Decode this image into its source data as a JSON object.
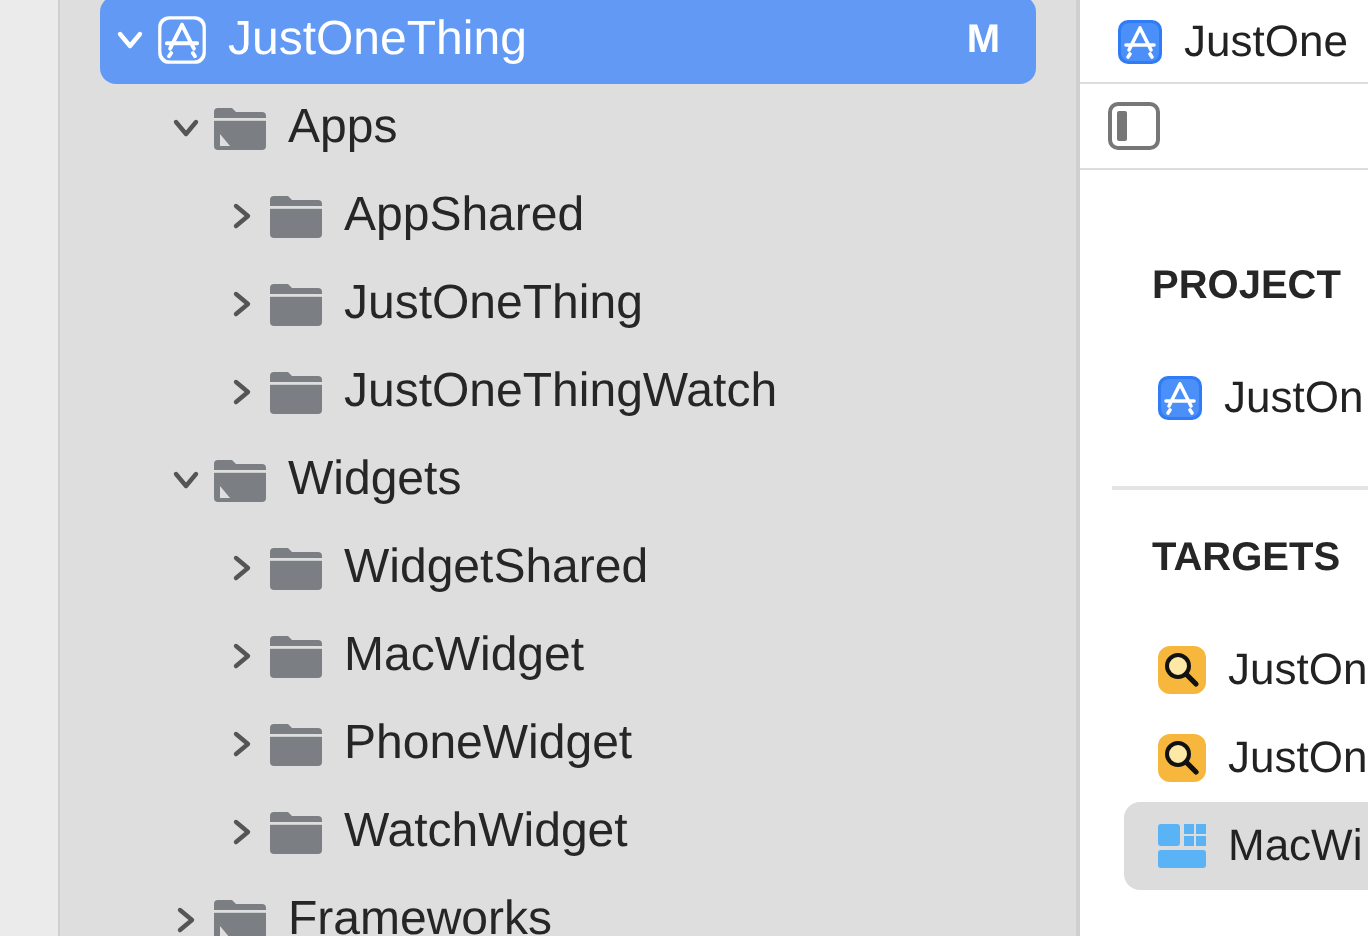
{
  "navigator": {
    "items": [
      {
        "name": "JustOneThing",
        "kind": "project",
        "expanded": true,
        "selected": true,
        "badge": "M",
        "children": [
          {
            "name": "Apps",
            "kind": "group",
            "expanded": true,
            "selected": false,
            "children": [
              {
                "name": "AppShared",
                "kind": "folder",
                "expanded": false,
                "selected": false
              },
              {
                "name": "JustOneThing",
                "kind": "folder",
                "expanded": false,
                "selected": false
              },
              {
                "name": "JustOneThingWatch",
                "kind": "folder",
                "expanded": false,
                "selected": false
              }
            ]
          },
          {
            "name": "Widgets",
            "kind": "group",
            "expanded": true,
            "selected": false,
            "children": [
              {
                "name": "WidgetShared",
                "kind": "folder",
                "expanded": false,
                "selected": false
              },
              {
                "name": "MacWidget",
                "kind": "folder",
                "expanded": false,
                "selected": false
              },
              {
                "name": "PhoneWidget",
                "kind": "folder",
                "expanded": false,
                "selected": false
              },
              {
                "name": "WatchWidget",
                "kind": "folder",
                "expanded": false,
                "selected": false
              }
            ]
          },
          {
            "name": "Frameworks",
            "kind": "group",
            "expanded": false,
            "selected": false
          }
        ]
      }
    ]
  },
  "editor": {
    "title": "JustOne",
    "sections": [
      {
        "heading": "PROJECT",
        "items": [
          {
            "name": "JustOn",
            "kind": "project",
            "selected": false
          }
        ]
      },
      {
        "heading": "TARGETS",
        "items": [
          {
            "name": "JustOn",
            "kind": "app",
            "selected": false
          },
          {
            "name": "JustOn",
            "kind": "app",
            "selected": false
          },
          {
            "name": "MacWi",
            "kind": "widget",
            "selected": true
          }
        ]
      }
    ]
  }
}
